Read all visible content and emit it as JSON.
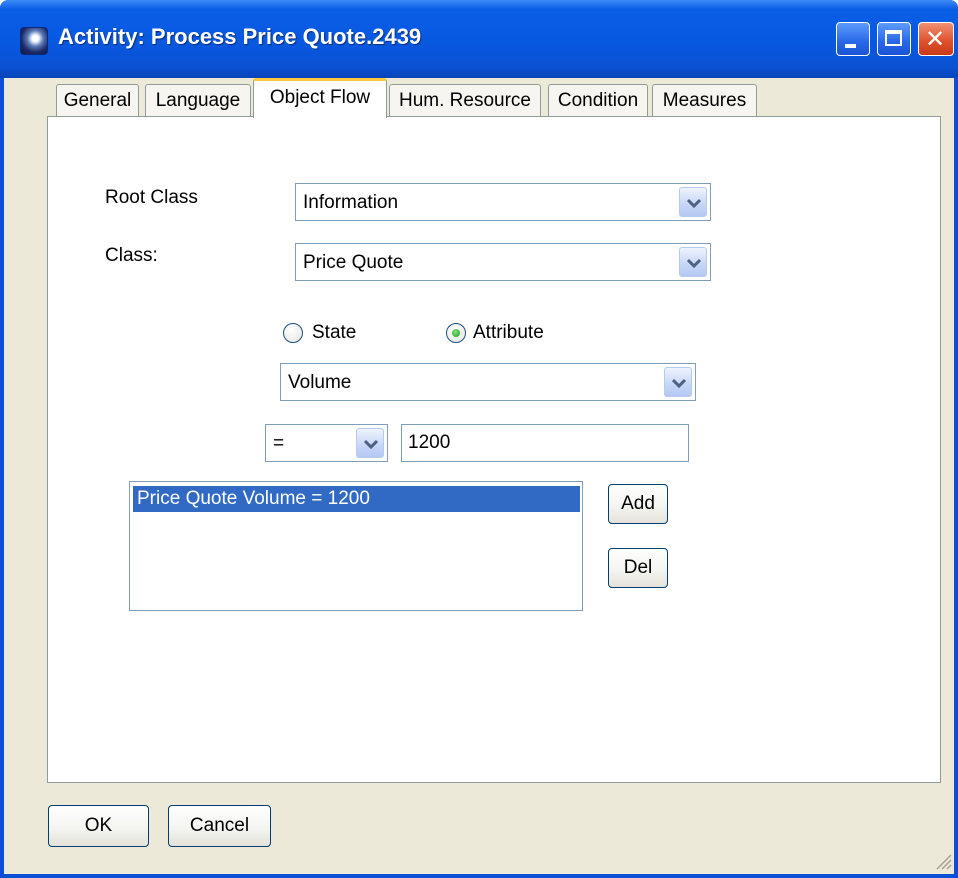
{
  "window": {
    "title": "Activity: Process Price Quote.2439",
    "controls": [
      "minimize-icon",
      "maximize-icon",
      "close-icon"
    ]
  },
  "tabs": [
    {
      "label": "General"
    },
    {
      "label": "Language"
    },
    {
      "label": "Object Flow",
      "active": true
    },
    {
      "label": "Hum. Resource"
    },
    {
      "label": "Condition"
    },
    {
      "label": "Measures"
    }
  ],
  "form": {
    "root_class_label": "Root Class",
    "root_class_value": "Information",
    "class_label": "Class:",
    "class_value": "Price Quote",
    "radio_state_label": "State",
    "radio_attribute_label": "Attribute",
    "selected_radio": "Attribute",
    "attribute_value": "Volume",
    "operator_value": "=",
    "value_input": "1200"
  },
  "conditions_list": {
    "items": [
      "Price Quote Volume = 1200"
    ],
    "selected_index": 0
  },
  "buttons": {
    "add": "Add",
    "del": "Del",
    "ok": "OK",
    "cancel": "Cancel"
  },
  "colors": {
    "titlebar": "#0a5ee6",
    "selection": "#316ac5",
    "active_tab_accent": "#ffc83c"
  }
}
